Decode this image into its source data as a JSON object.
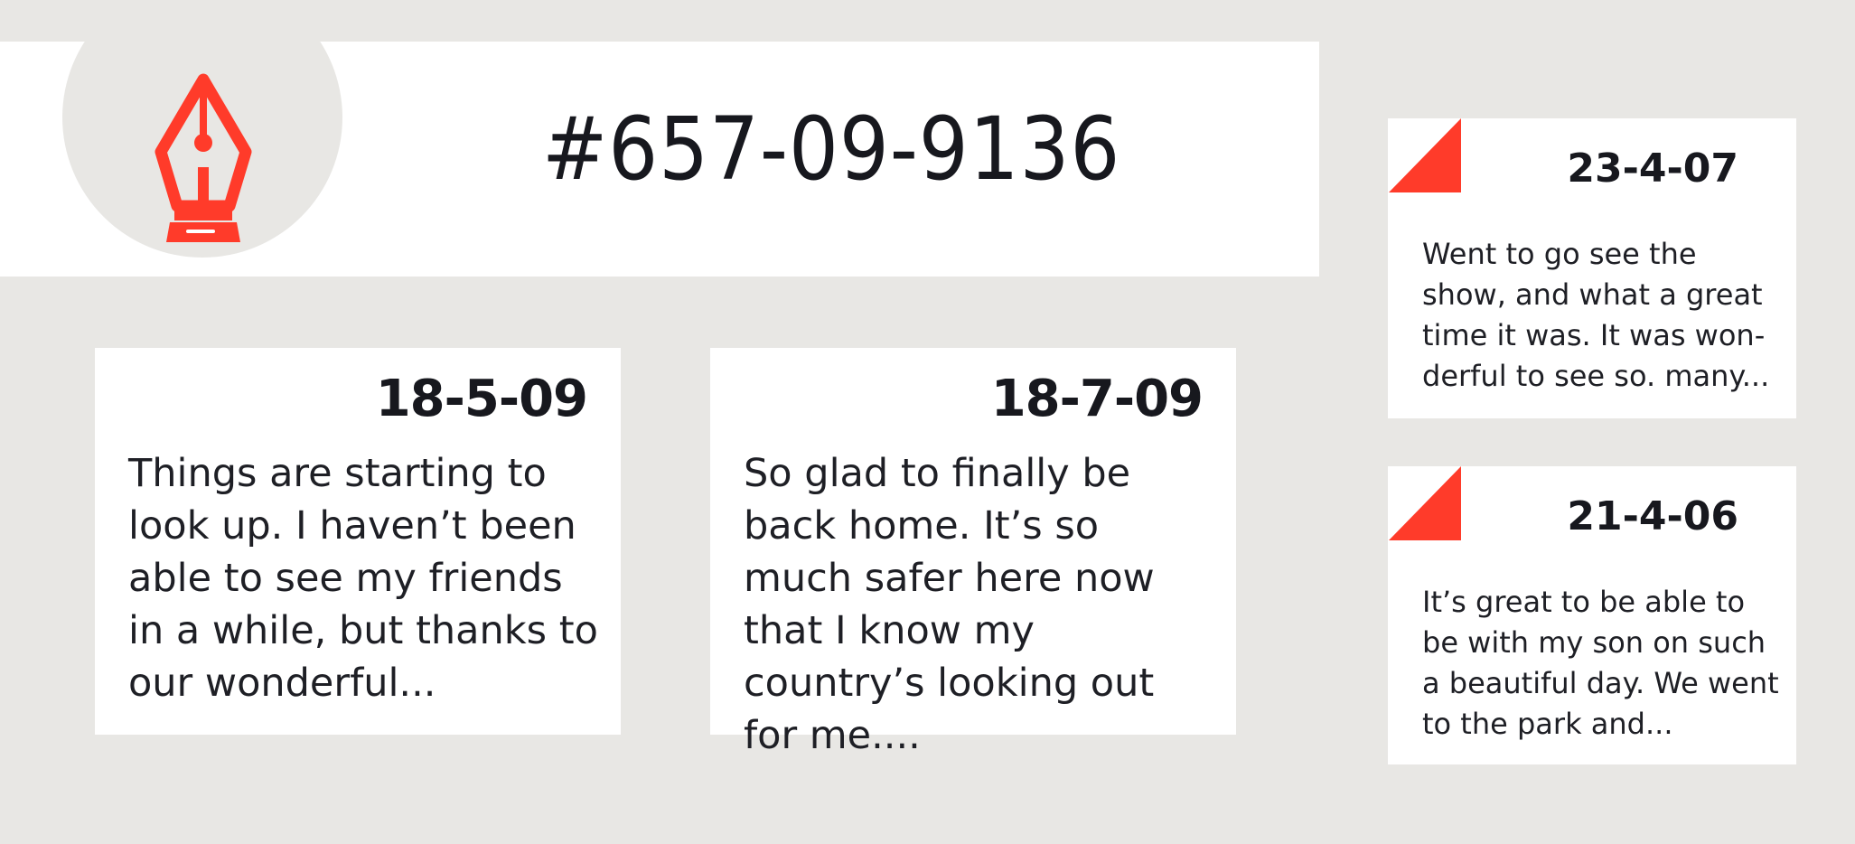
{
  "colors": {
    "accent": "#ff3b2a",
    "background": "#e8e7e4",
    "card": "#ffffff",
    "text": "#17181e"
  },
  "header": {
    "logo_icon": "pen-nib-icon",
    "title": "#657-09-9136"
  },
  "entries": [
    {
      "date": "18-5-09",
      "text": "Things are starting to look up. I haven’t been able to see my friends in a while, but thanks to our wonderful..."
    },
    {
      "date": "18-7-09",
      "text": "So glad to finally be back home. It’s so much safer here now that I know my country’s looking out for me...."
    }
  ],
  "side_entries": [
    {
      "date": "23-4-07",
      "text": "Went to go see the show, and what a great time it was. It was won-derful to see so. many..."
    },
    {
      "date": "21-4-06",
      "text": "It’s great to be able to be with my son on such a beautiful day. We went to the park and..."
    }
  ]
}
